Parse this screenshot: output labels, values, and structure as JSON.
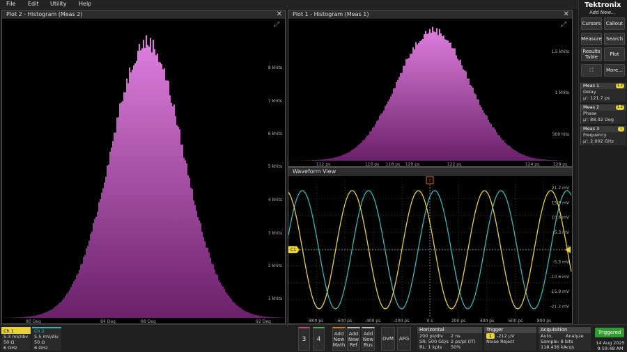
{
  "menu": [
    "File",
    "Edit",
    "Utility",
    "Help"
  ],
  "plot2": {
    "title": "Plot 2 - Histogram (Meas 2)",
    "y_ticks": [
      "8 khits",
      "7 khits",
      "6 khits",
      "5 khits",
      "4 khits",
      "3 khits",
      "2 khits",
      "1 khits"
    ],
    "x_ticks": [
      "80 Deg",
      "84 Deg",
      "88 Deg",
      "92 Deg"
    ]
  },
  "plot1": {
    "title": "Plot 1 - Histogram (Meas 1)",
    "y_ticks": [
      "1.5 khits",
      "1 khits",
      "500 hits"
    ],
    "x_ticks": [
      "112 ps",
      "116 ps",
      "118 ps",
      "120 ps",
      "122 ps",
      "124 ps",
      "128 ps"
    ]
  },
  "waveform": {
    "title": "Waveform View",
    "trigger_marker": "T",
    "ch_marker": "C1",
    "y_ticks": [
      "21.2 mV",
      "15.9 mV",
      "10.6 mV",
      "5.3 mV",
      "0",
      "-5.3 mV",
      "-10.6 mV",
      "-15.9 mV",
      "-21.2 mV"
    ],
    "x_ticks": [
      "-800 ps",
      "-600 ps",
      "-400 ps",
      "-200 ps",
      "0 s",
      "200 ps",
      "400 ps",
      "600 ps",
      "800 ps"
    ],
    "colors": {
      "ch1": "#e8d23a",
      "ch2": "#3ab6b6"
    }
  },
  "side": {
    "brand": "Tektronix",
    "add_new": "Add New...",
    "buttons": [
      "Cursors",
      "Callout",
      "Measure",
      "Search",
      "Results Table",
      "Plot",
      "More..."
    ],
    "meas": [
      {
        "head": "Meas 1",
        "label": "Delay",
        "value": "μ': 121.7 ps",
        "badge": "1 2"
      },
      {
        "head": "Meas 2",
        "label": "Phase",
        "value": "μ': 88.02 Deg",
        "badge": "1 2"
      },
      {
        "head": "Meas 3",
        "label": "Frequency",
        "value": "μ': 2.002 GHz",
        "badge": "1"
      }
    ]
  },
  "bottom": {
    "ch1": {
      "head": "Ch 1",
      "lines": [
        "5.3 mV/div",
        "50 Ω",
        "6 GHz"
      ]
    },
    "ch2": {
      "head": "Ch 2",
      "lines": [
        "5.5 mV/div",
        "50 Ω",
        "6 GHz"
      ]
    },
    "num_buttons": [
      "3",
      "4"
    ],
    "add_buttons": [
      "Add New Math",
      "Add New Ref",
      "Add New Bus"
    ],
    "tools": [
      "DVM",
      "AFG"
    ],
    "horizontal": {
      "head": "Horizontal",
      "r1a": "200 ps/div",
      "r1b": "2 ns",
      "r2a": "SR: 500 GS/s",
      "r2b": "2 ps/pt (IT)",
      "r3a": "RL: 1 kpts",
      "r3b": "50%"
    },
    "trigger": {
      "head": "Trigger",
      "r1": "-212 μV",
      "r2": "Noise Reject"
    },
    "acquisition": {
      "head": "Acquisition",
      "r1a": "Auto,",
      "r1b": "Analyze",
      "r2": "Sample: 8 bits",
      "r3": "118.436 kAcqs"
    },
    "triggered": "Triggered",
    "date": "14 Aug 2025",
    "time": "9:59:48 AM"
  }
}
